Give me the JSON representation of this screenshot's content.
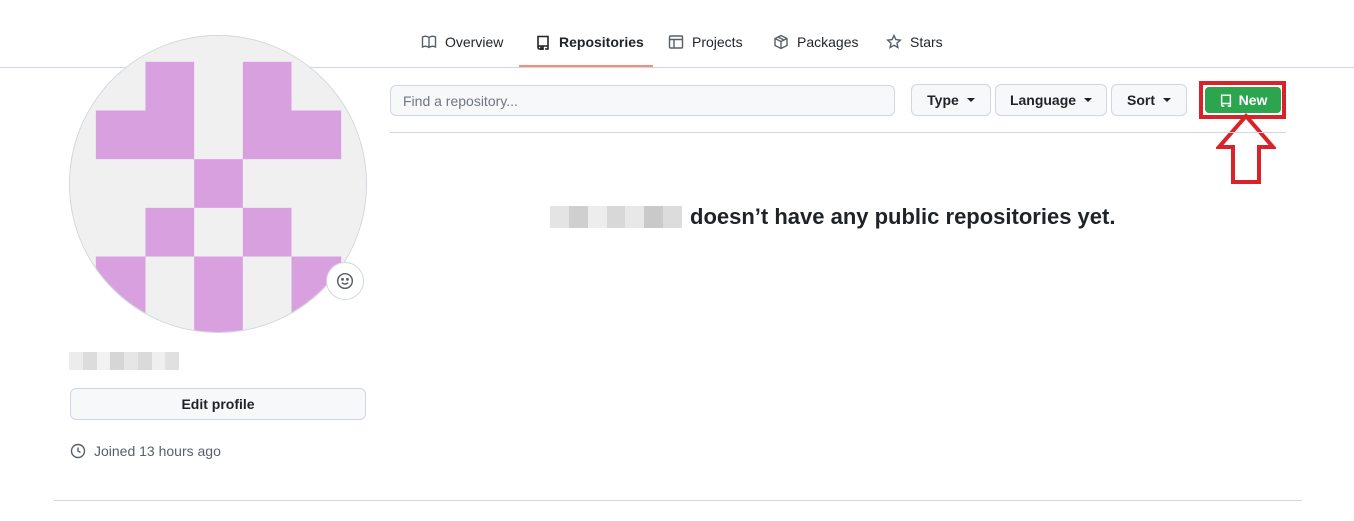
{
  "nav": {
    "tabs": [
      {
        "label": "Overview",
        "icon": "book-icon"
      },
      {
        "label": "Repositories",
        "icon": "repo-icon",
        "active": true
      },
      {
        "label": "Projects",
        "icon": "table-icon"
      },
      {
        "label": "Packages",
        "icon": "package-icon"
      },
      {
        "label": "Stars",
        "icon": "star-icon"
      }
    ],
    "active_underline_color": "#fd8c73"
  },
  "profile": {
    "avatar_color": "#d9a0e0",
    "avatar_bg": "#f0f0f0",
    "edit_label": "Edit profile",
    "joined_text": "Joined 13 hours ago"
  },
  "repos": {
    "search_placeholder": "Find a repository...",
    "type_label": "Type",
    "language_label": "Language",
    "sort_label": "Sort",
    "new_label": "New",
    "empty_message": "doesn’t have any public repositories yet.",
    "new_button_color": "#2da44e",
    "highlight_color": "#d9232b"
  }
}
